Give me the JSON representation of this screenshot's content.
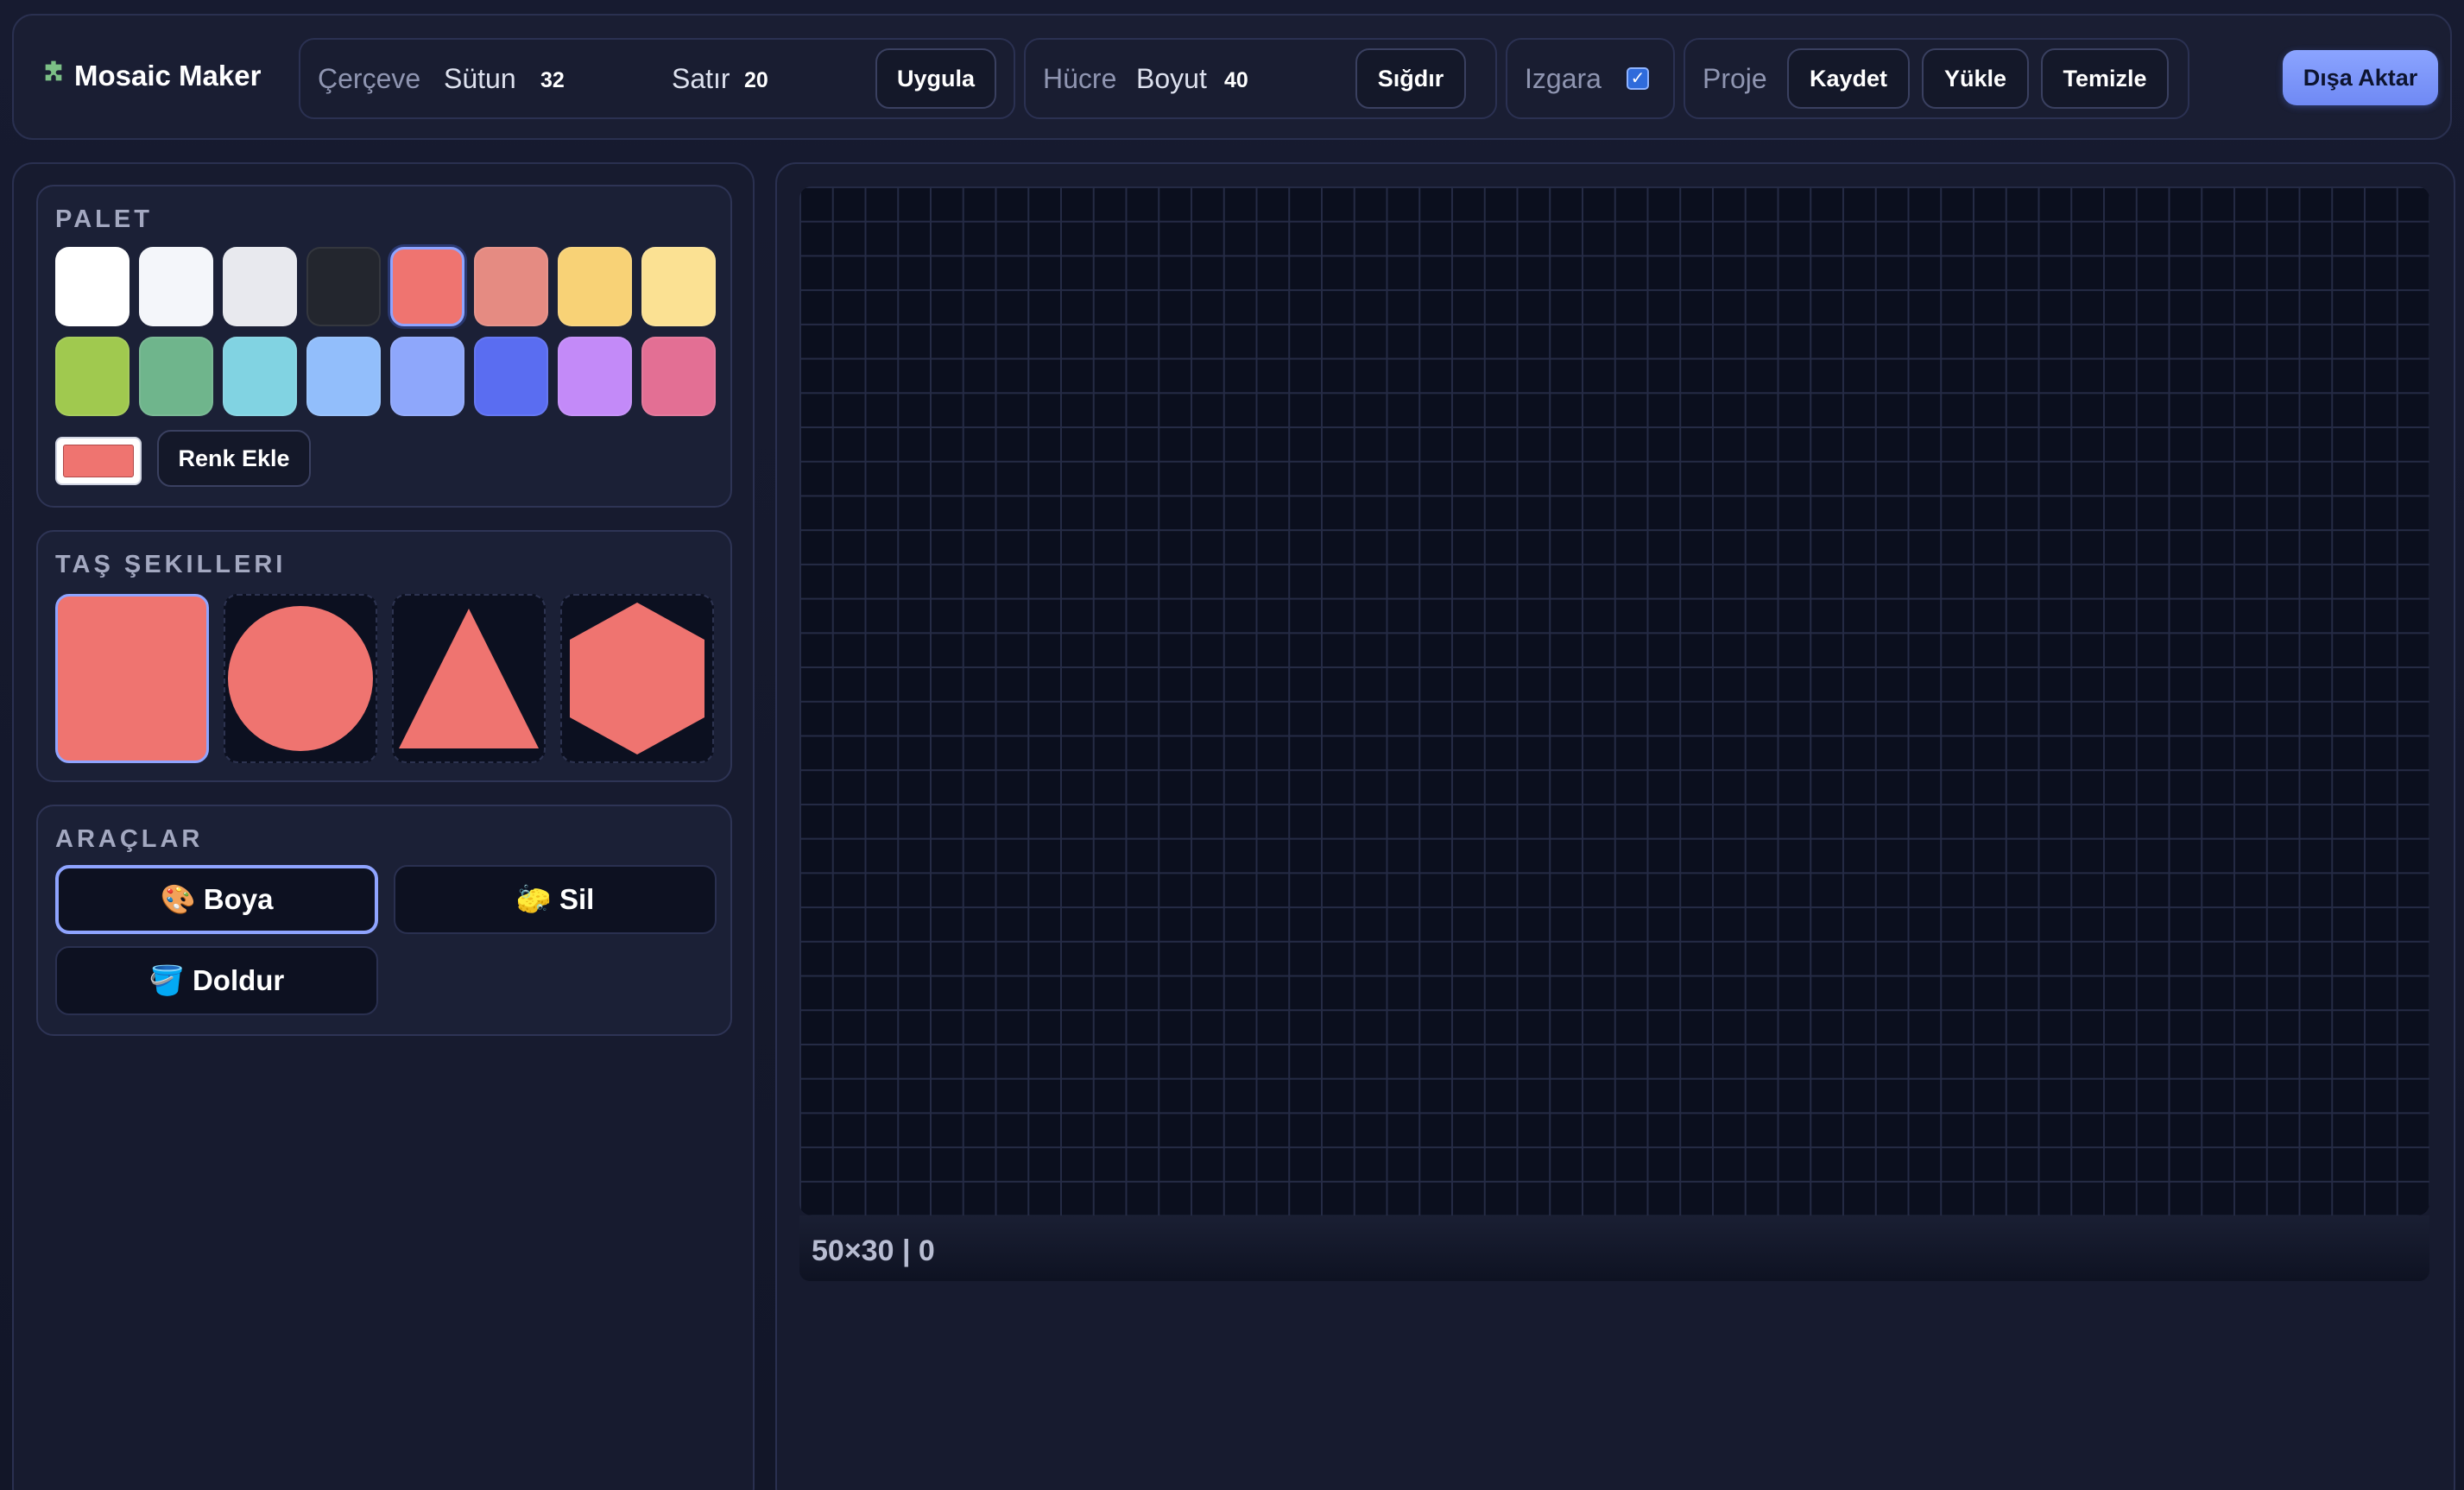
{
  "app": {
    "title": "Mosaic Maker",
    "icon": "puzzle-icon"
  },
  "toolbar": {
    "frame": {
      "title": "Çerçeve",
      "columns_label": "Sütun",
      "columns_value": "32",
      "rows_label": "Satır",
      "rows_value": "20",
      "apply_label": "Uygula"
    },
    "cell": {
      "title": "Hücre",
      "size_label": "Boyut",
      "size_value": "40",
      "fit_label": "Sığdır"
    },
    "grid": {
      "title": "Izgara",
      "checked": true
    },
    "project": {
      "title": "Proje",
      "save_label": "Kaydet",
      "load_label": "Yükle",
      "clear_label": "Temizle"
    },
    "export_label": "Dışa Aktar"
  },
  "palette": {
    "title": "PALET",
    "colors": [
      "#ffffff",
      "#f4f6fa",
      "#e8e9ee",
      "#23262e",
      "#ef7470",
      "#e58b82",
      "#f8d276",
      "#fbe193",
      "#a0c94f",
      "#6fb58c",
      "#81d3e2",
      "#92befb",
      "#8ea7fb",
      "#5a6df1",
      "#c38af8",
      "#e36f94"
    ],
    "selected_index": 4,
    "current_color": "#ef7470",
    "add_color_label": "Renk Ekle"
  },
  "shapes": {
    "title": "TAŞ ŞEKILLERI",
    "items": [
      "square",
      "circle",
      "triangle",
      "hexagon"
    ],
    "selected": "square",
    "fill": "#ef7470"
  },
  "tools": {
    "title": "ARAÇLAR",
    "paint_label": "🎨 Boya",
    "erase_label": "🧽 Sil",
    "fill_label": "🪣 Doldur",
    "selected": "paint"
  },
  "canvas": {
    "status": "50×30 | 0"
  }
}
